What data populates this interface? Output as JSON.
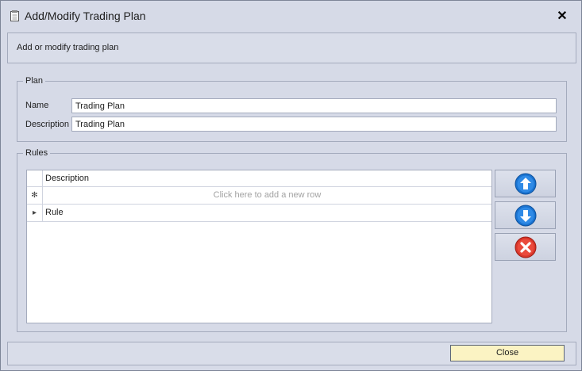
{
  "window": {
    "title": "Add/Modify Trading Plan",
    "close_glyph": "✕",
    "icon": "document-icon"
  },
  "header": {
    "text": "Add or modify trading plan"
  },
  "plan_group": {
    "title": "Plan",
    "name_label": "Name",
    "name_value": "Trading Plan",
    "description_label": "Description",
    "description_value": "Trading Plan"
  },
  "rules_group": {
    "title": "Rules",
    "columns": [
      "Description"
    ],
    "new_row_indicator": "✻",
    "new_row_text": "Click here to add a new row",
    "rows": [
      {
        "indicator": "▸",
        "description": "Rule"
      }
    ],
    "buttons": {
      "move_up_icon": "arrow-up-icon",
      "move_down_icon": "arrow-down-icon",
      "delete_icon": "delete-icon"
    }
  },
  "footer": {
    "close_label": "Close"
  },
  "colors": {
    "window_bg": "#d6dae7",
    "border": "#a4abbd",
    "blue_button": "#1a73d1",
    "red_button": "#d9362a",
    "close_button_bg": "#fbf3c3"
  }
}
